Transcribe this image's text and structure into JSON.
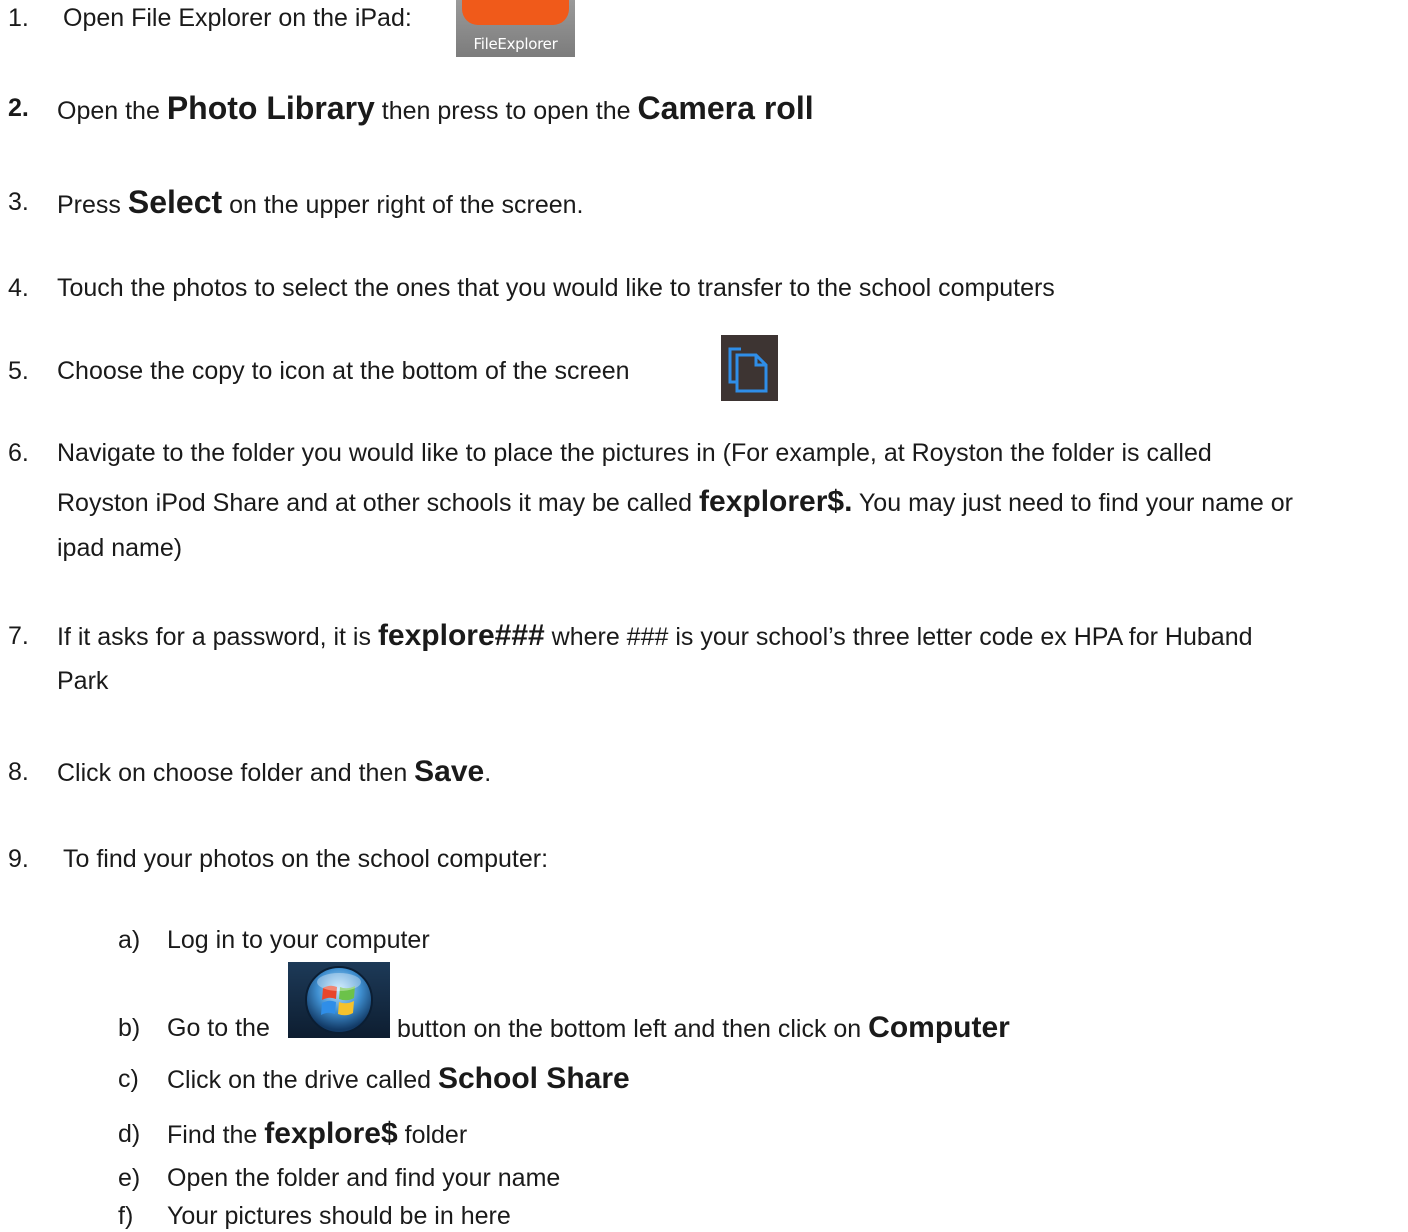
{
  "icons": {
    "app_icon": "file-explorer-app-icon",
    "copy_icon": "copy-to-icon",
    "start_icon": "windows-start-orb-icon"
  },
  "colors": {
    "app_orange": "#f05a1a",
    "copy_blue": "#2f8ee8",
    "copy_bg": "#3d3432"
  },
  "app_icon_label": "FileExplorer",
  "steps": [
    {
      "num": "1.",
      "text": "Open File Explorer on the iPad:"
    },
    {
      "num": "2.",
      "pre": "Open the ",
      "b1": "Photo Library",
      "mid": " then press to open the ",
      "b2": "Camera roll"
    },
    {
      "num": "3.",
      "pre": "Press ",
      "b1": "Select",
      "post": " on the upper right of the screen."
    },
    {
      "num": "4.",
      "text": "Touch the photos  to select the ones that you would like to transfer to the school computers"
    },
    {
      "num": "5.",
      "text": "Choose the copy to icon at the bottom of the screen"
    },
    {
      "num": "6.",
      "line1": "Navigate to the folder you would like to place the pictures in  (For example, at Royston the folder is called",
      "pre2": "Royston iPod Share and at other schools it may be called ",
      "b1": "fexplorer$.",
      "post2": " You may just need to find your name or",
      "line3": "ipad name)"
    },
    {
      "num": "7.",
      "pre": "If it asks for a password, it is ",
      "b1": "fexplore###",
      "post": " where ### is your school’s three letter code ex HPA for Huband",
      "line2": "Park"
    },
    {
      "num": "8.",
      "pre": "Click on choose folder and then ",
      "b1": "Save",
      "post": "."
    },
    {
      "num": "9.",
      "text": "To find your photos on the school computer:"
    }
  ],
  "substeps": [
    {
      "num": "a)",
      "text": "Log in to your computer"
    },
    {
      "num": "b)",
      "pre": "Go to the ",
      "post": " button on the bottom left and then click on ",
      "b1": "Computer"
    },
    {
      "num": "c)",
      "pre": "Click on the drive called ",
      "b1": "School Share"
    },
    {
      "num": "d)",
      "pre": "Find the ",
      "b1": "fexplore$",
      "post": "  folder"
    },
    {
      "num": "e)",
      "text": "Open the folder and find your name"
    },
    {
      "num": "f)",
      "text": "Your pictures should be in here"
    }
  ]
}
